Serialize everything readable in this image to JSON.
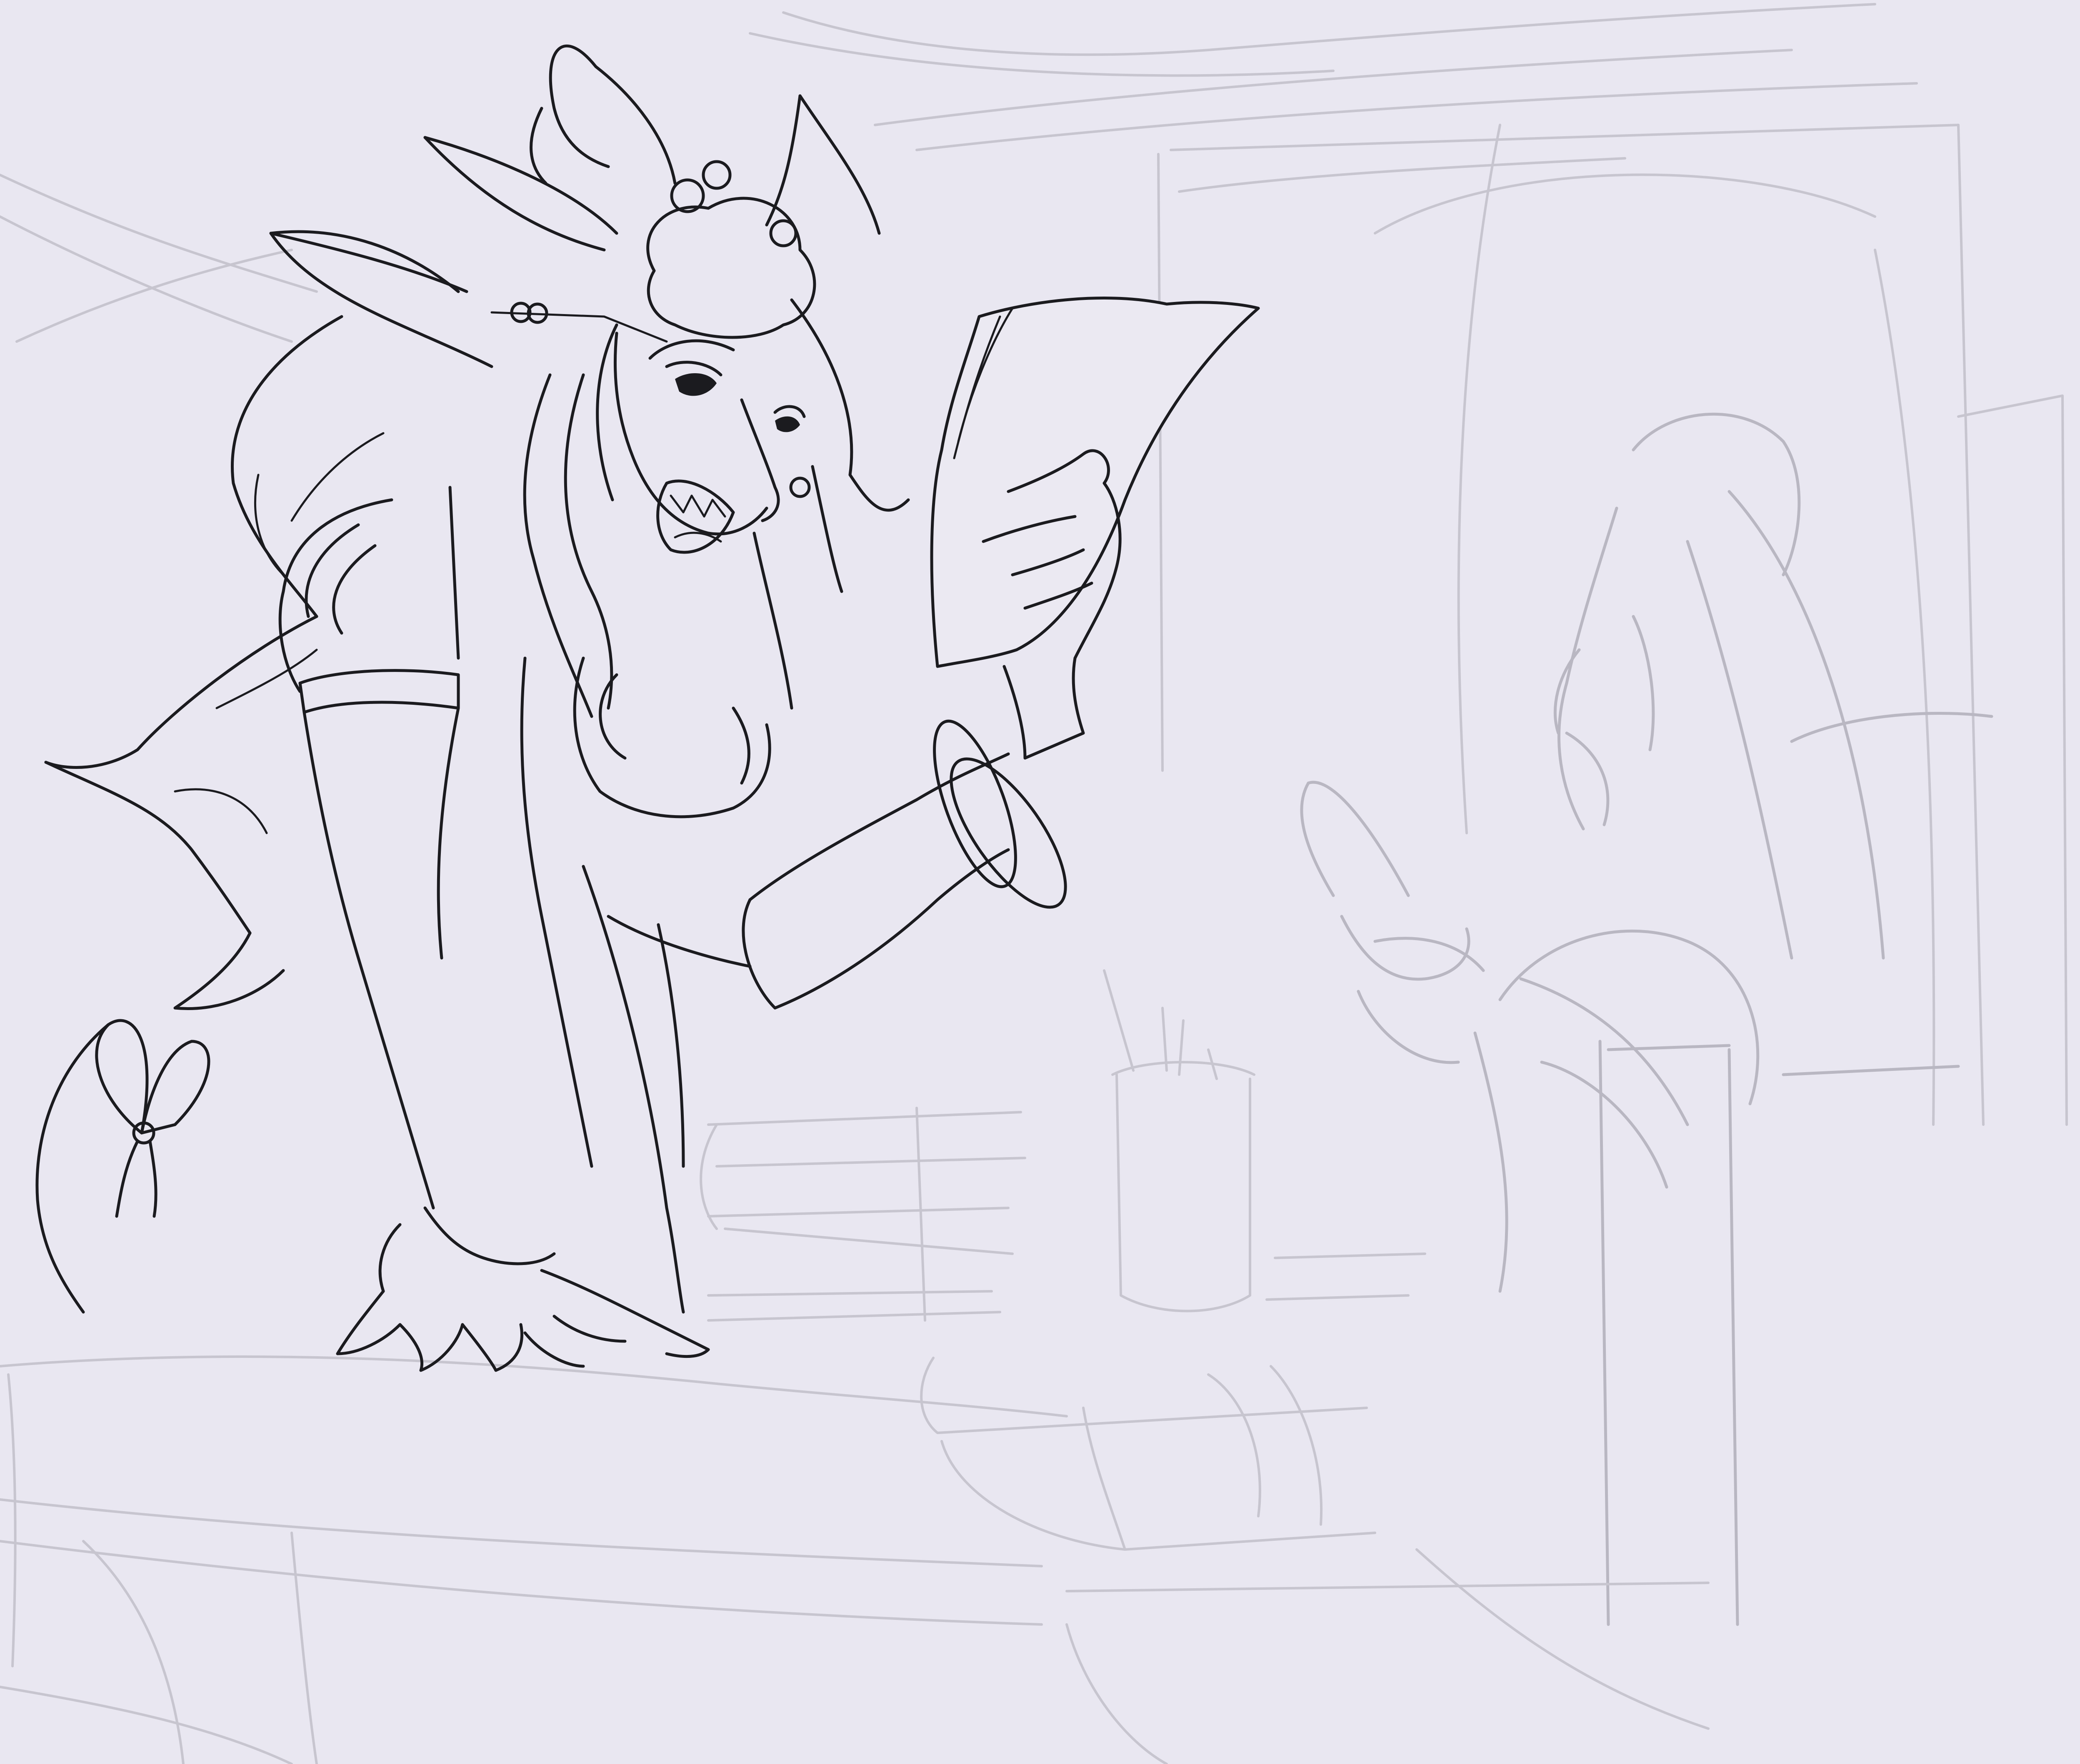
{
  "artwork": {
    "style": "line art illustration over rough pencil sketch",
    "background_color": "#e9e7f1",
    "ink_color": "#1b1b1f",
    "sketch_color": "#c7c5cf",
    "subjects": {
      "foreground_figure": "woman-with-ornate-hair-holding-paper",
      "background_figure": "seated-figure-sketch",
      "props": [
        "letter-paper",
        "bangles",
        "bow-ribbon",
        "desk",
        "book-stack",
        "pen-cup",
        "scrolls"
      ]
    }
  }
}
